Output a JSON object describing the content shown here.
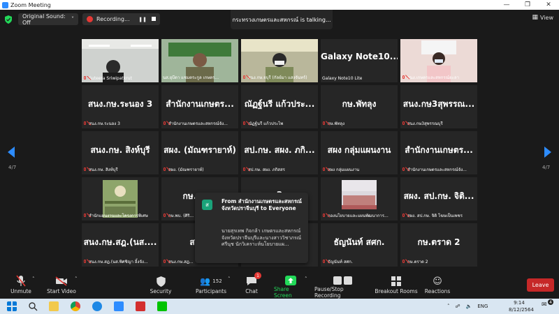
{
  "window": {
    "title": "Zoom Meeting"
  },
  "topbar": {
    "audio_label": "Original Sound: Off",
    "recording_label": "Recording...",
    "talking_text": "กระทรวงเกษตรและสหกรณ์ is talking...",
    "view_label": "View"
  },
  "pagination": {
    "left_label": "4/7",
    "right_label": "4/7"
  },
  "tiles": [
    {
      "big": "",
      "name": "Suteera Sriwipatkrut",
      "mic_off": true,
      "video": "office"
    },
    {
      "big": "",
      "name": "นส.ยุบีดา แซมตระกูล เกษตร...",
      "mic_off": false,
      "video": "woman_green"
    },
    {
      "big": "",
      "name": "สนง.กษ.จบุรี (กัลย์มา แสงจันทร์)",
      "mic_off": true,
      "video": "woman_mask"
    },
    {
      "big": "Galaxy  Note10...",
      "name": "Galaxy Note10 Lite",
      "mic_off": false,
      "video": ""
    },
    {
      "big": "",
      "name": "สนง.เกษตรและสหกรณ์ยะลา",
      "mic_off": true,
      "video": "woman_pink"
    },
    {
      "big": "สนง.กษ.ระนอง 3",
      "name": "สนง.กษ.ระนอง 3",
      "mic_off": true,
      "video": ""
    },
    {
      "big": "สำนักงานเกษตร...",
      "name": "สำนักงานเกษตรและสหกรณ์จัง...",
      "mic_off": true,
      "video": ""
    },
    {
      "big": "ณัฏฐ์นรี แก้วประ...",
      "name": "ณัฏฐ์นรี แก้วประไพ",
      "mic_off": true,
      "video": ""
    },
    {
      "big": "กษ.พัทลุง",
      "name": "กษ.พัทลุง",
      "mic_off": true,
      "video": ""
    },
    {
      "big": "สนง.กษ3สุพรรณ...",
      "name": "สนง.กษ3สุพรรณบุรี",
      "mic_off": true,
      "video": ""
    },
    {
      "big": "สนง.กษ. สิงห์บุรี",
      "name": "สนง.กษ. สิงห์บุรี",
      "mic_off": true,
      "video": ""
    },
    {
      "big": "สผง. (มัณฑรายาห์)",
      "name": "สผง. (มัณฑรายาห์)",
      "mic_off": true,
      "video": ""
    },
    {
      "big": "สป.กษ. สผง. ภกิ...",
      "name": "สป.กษ. สผง. ภกิสสร",
      "mic_off": true,
      "video": ""
    },
    {
      "big": "สผง กลุ่มแผนงาน",
      "name": "สผง กลุ่มแผนงาน",
      "mic_off": true,
      "video": ""
    },
    {
      "big": "สำนักงานเกษตร...",
      "name": "สำนักงานเกษตรและสหกรณ์จัง...",
      "mic_off": true,
      "video": ""
    },
    {
      "big": "",
      "name": "สำนักแผนงานและโครงการพิเศษ",
      "mic_off": true,
      "video": "logo"
    },
    {
      "big": "กษ.พบ...",
      "name": "กษ.พบ. (ศิริ...",
      "mic_off": true,
      "video": ""
    },
    {
      "big": "2",
      "name": "",
      "mic_off": false,
      "video": ""
    },
    {
      "big": "",
      "name": "กองนโยบายและแผนพัฒนาการ...",
      "mic_off": true,
      "video": "group"
    },
    {
      "big": "สผง. สป.กษ. จิติ...",
      "name": "สผง. สป.กษ. จิติ โฆษเป็นเพชร",
      "mic_off": true,
      "video": ""
    },
    {
      "big": "สนง.กษ.สฎ.(นส....",
      "name": "สนง.กษ.สฎ.(นส.พิศชิญา อิ้งจัง...",
      "mic_off": true,
      "video": ""
    },
    {
      "big": "สน...",
      "name": "สนง.กษ.สฎ...",
      "mic_off": true,
      "video": ""
    },
    {
      "big": "",
      "name": "",
      "mic_off": false,
      "video": ""
    },
    {
      "big": "ธัญนันท์ สศก.",
      "name": "ธัญนันท์ สศก.",
      "mic_off": true,
      "video": ""
    },
    {
      "big": "กษ.ตราด 2",
      "name": "กษ.ตราด 2",
      "mic_off": true,
      "video": ""
    }
  ],
  "chat_popup": {
    "avatar_letter": "ส",
    "from": "From สำนักงานเกษตรและสหกรณ์จังหวัดปราจีนบุรี to Everyone",
    "message": "นายสุรเทพ  กิจกล้า เกษตรและสหกรณ์จังหวัดปราจีนบุรีและนางสาววิชาภรณ์ ศรีนุช นักวิเคราะห์นโยบายแผ..."
  },
  "toolbar": {
    "unmute": "Unmute",
    "start_video": "Start Video",
    "security": "Security",
    "participants": "Participants",
    "participants_count": "152",
    "chat": "Chat",
    "chat_badge": "1",
    "share": "Share Screen",
    "pause_rec": "Pause/Stop Recording",
    "breakout": "Breakout Rooms",
    "reactions": "Reactions",
    "leave": "Leave"
  },
  "taskbar": {
    "lang": "ENG",
    "time": "9:14",
    "date": "8/12/2564",
    "notif_count": "4"
  },
  "colors": {
    "accent": "#2d8cff",
    "share_green": "#23d959",
    "leave_red": "#c62828",
    "muted_red": "#e53935"
  }
}
